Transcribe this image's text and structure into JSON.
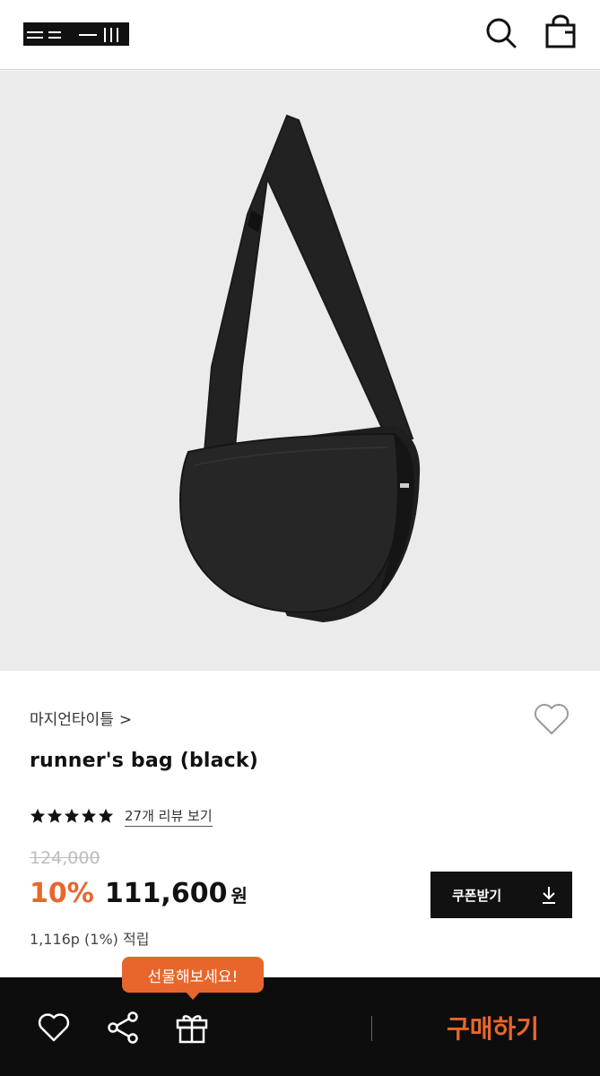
{
  "header": {
    "logo_icon": "brand-wordmark",
    "search_icon": "search-icon",
    "cart_icon": "shopping-bag-icon"
  },
  "product": {
    "brand": "마지언타이틀",
    "brand_chevron": ">",
    "title": "runner's bag (black)",
    "rating_stars": 5,
    "review_link": "27개 리뷰 보기",
    "original_price": "124,000",
    "discount": "10%",
    "sale_price": "111,600",
    "currency": "원",
    "points": "1,116p (1%) 적립",
    "coupon_button": "쿠폰받기"
  },
  "bottom_bar": {
    "tooltip": "선물해보세요!",
    "buy_button": "구매하기"
  },
  "colors": {
    "accent": "#e8662b",
    "bar": "#0d0d0d",
    "hero_bg": "#ebebeb"
  }
}
